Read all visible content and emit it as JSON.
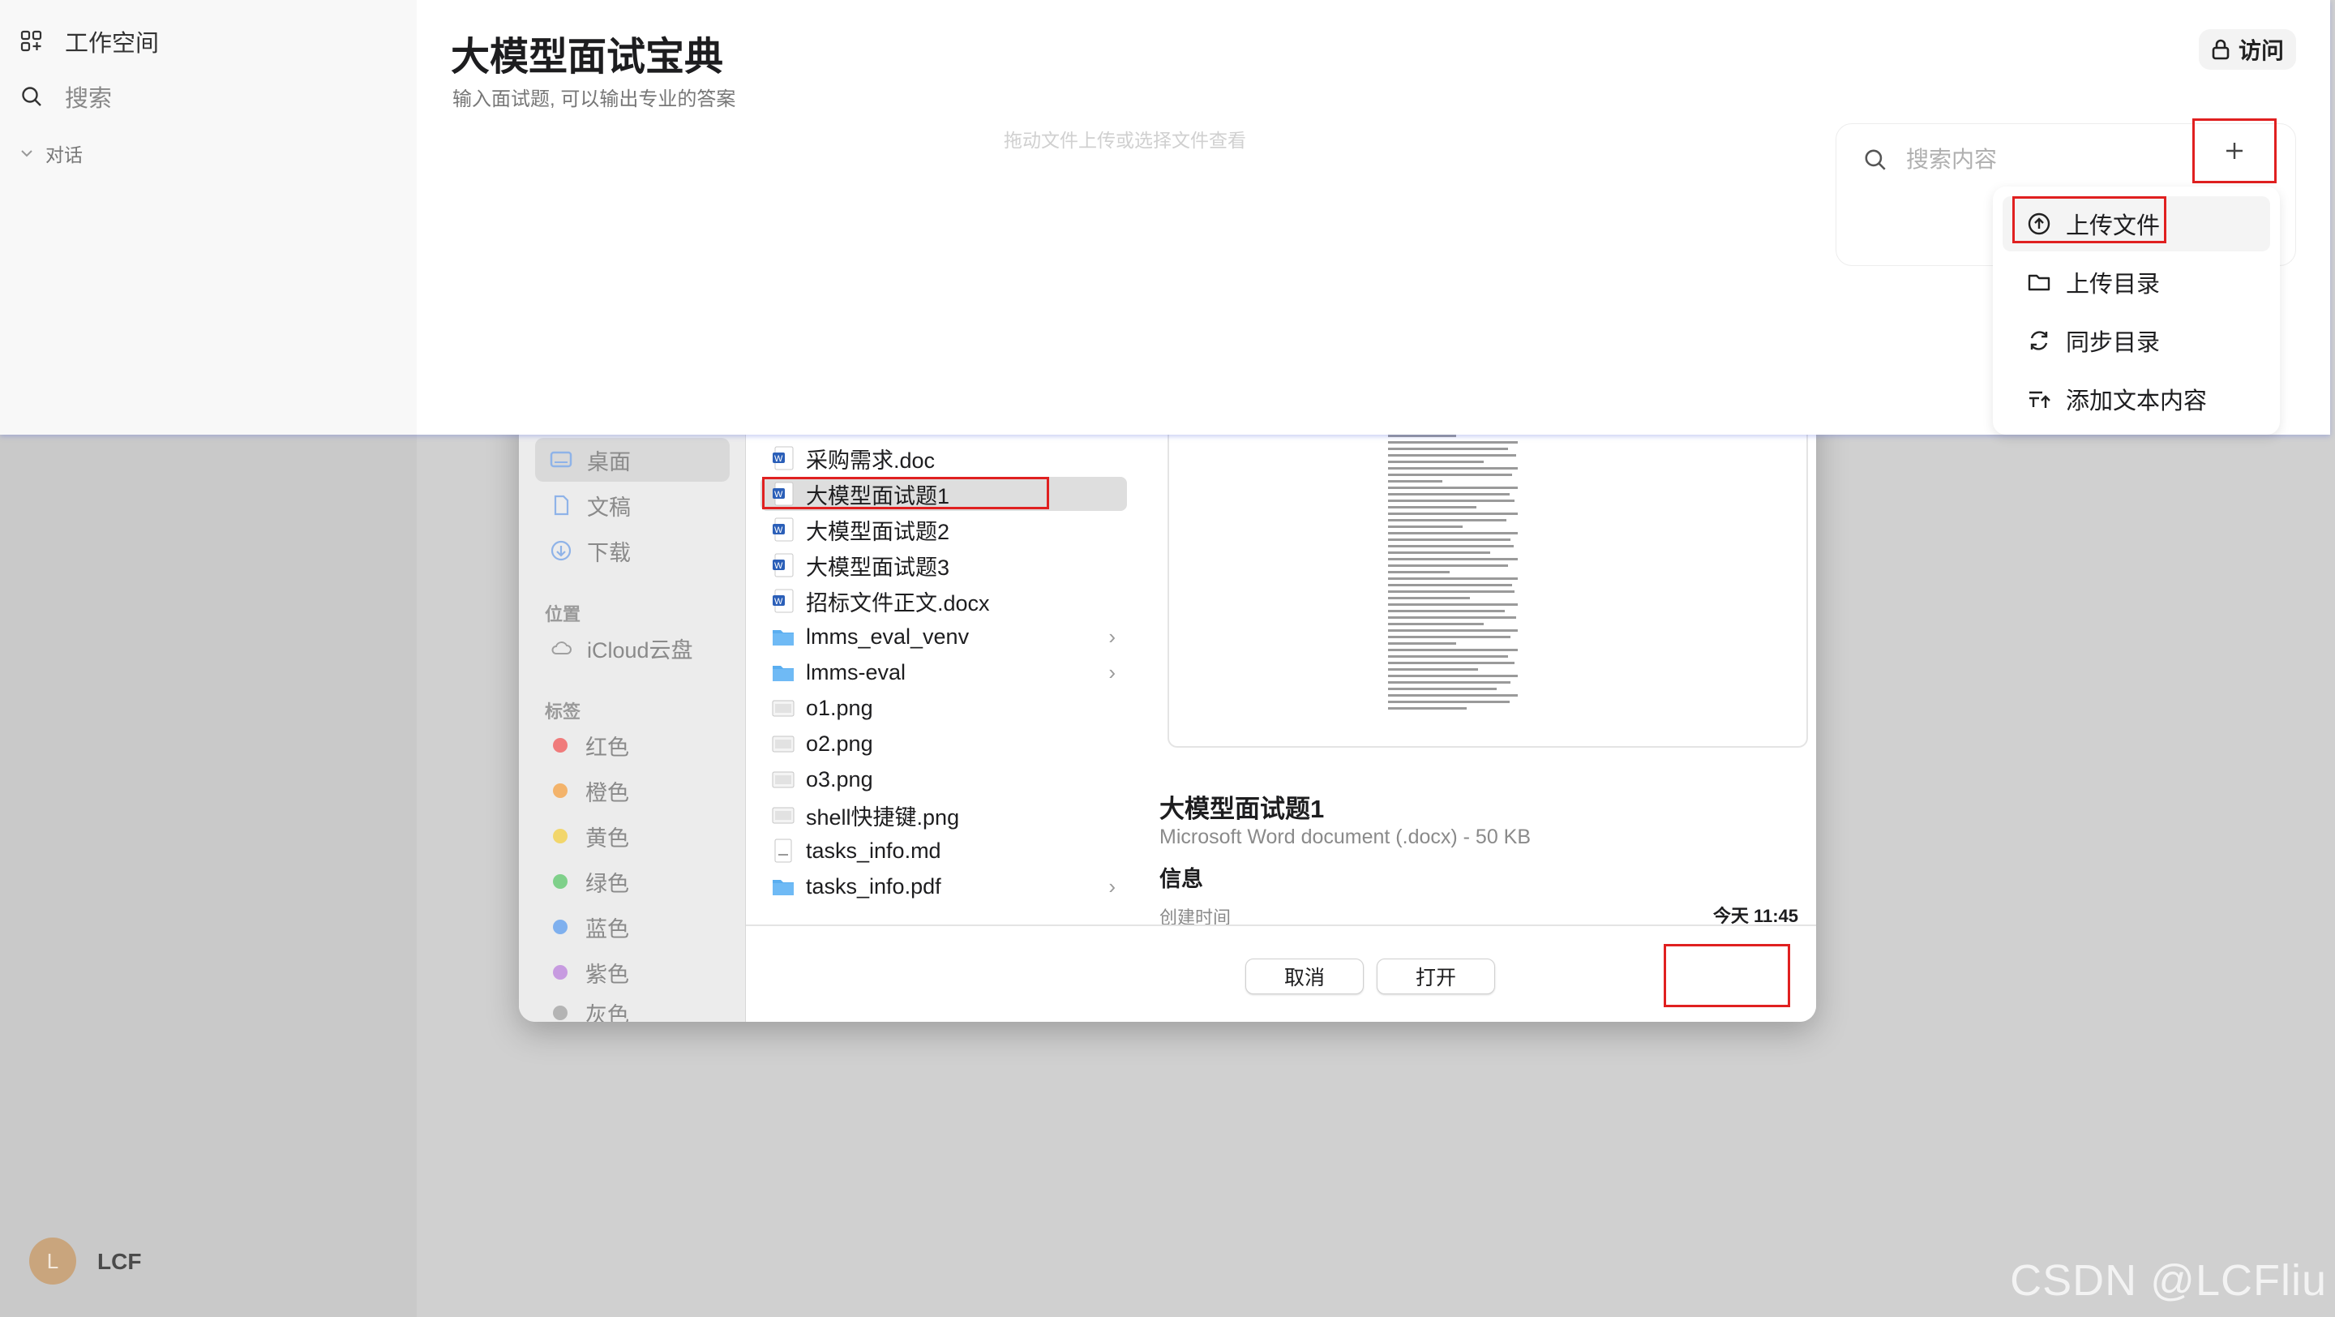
{
  "app": {
    "workspace_label": "工作空间",
    "search_label": "搜索",
    "conversations_label": "对话",
    "user_initial": "L",
    "user_name": "LCF"
  },
  "page": {
    "title": "大模型面试宝典",
    "subtitle": "输入面试题, 可以输出专业的答案",
    "drop_hint": "拖动文件上传或选择文件查看",
    "access_label": "访问",
    "search_placeholder": "搜索内容"
  },
  "upload_menu": {
    "items": [
      {
        "label": "上传文件",
        "icon": "upload-circle-icon"
      },
      {
        "label": "上传目录",
        "icon": "folder-icon"
      },
      {
        "label": "同步目录",
        "icon": "sync-icon"
      },
      {
        "label": "添加文本内容",
        "icon": "add-text-icon"
      }
    ]
  },
  "file_dialog": {
    "sidebar": {
      "favorites": [
        {
          "label": "桌面",
          "icon": "desktop-icon"
        },
        {
          "label": "文稿",
          "icon": "document-icon"
        },
        {
          "label": "下载",
          "icon": "download-icon"
        }
      ],
      "locations_header": "位置",
      "locations": [
        {
          "label": "iCloud云盘",
          "icon": "cloud-icon"
        }
      ],
      "tags_header": "标签",
      "tags": [
        {
          "label": "红色",
          "color": "#f07b7b"
        },
        {
          "label": "橙色",
          "color": "#f3b36b"
        },
        {
          "label": "黄色",
          "color": "#f2d66b"
        },
        {
          "label": "绿色",
          "color": "#7fd08a"
        },
        {
          "label": "蓝色",
          "color": "#7fb0ee"
        },
        {
          "label": "紫色",
          "color": "#c79be0"
        },
        {
          "label": "灰色",
          "color": "#b4b4b4"
        }
      ]
    },
    "files": [
      {
        "name": "采购需求.doc",
        "type": "word"
      },
      {
        "name": "大模型面试题1",
        "type": "word"
      },
      {
        "name": "大模型面试题2",
        "type": "word"
      },
      {
        "name": "大模型面试题3",
        "type": "word"
      },
      {
        "name": "招标文件正文.docx",
        "type": "word"
      },
      {
        "name": "lmms_eval_venv",
        "type": "folder"
      },
      {
        "name": "lmms-eval",
        "type": "folder"
      },
      {
        "name": "o1.png",
        "type": "image"
      },
      {
        "name": "o2.png",
        "type": "image"
      },
      {
        "name": "o3.png",
        "type": "image"
      },
      {
        "name": "shell快捷键.png",
        "type": "image"
      },
      {
        "name": "tasks_info.md",
        "type": "text"
      },
      {
        "name": "tasks_info.pdf",
        "type": "folder"
      }
    ],
    "preview": {
      "name": "大模型面试题1",
      "type_size": "Microsoft Word document (.docx) - 50 KB",
      "info_header": "信息",
      "created_label": "创建时间",
      "created_value": "今天 11:45"
    },
    "cancel_label": "取消",
    "open_label": "打开"
  },
  "watermark": "CSDN @LCFliu",
  "colors": {
    "annotation_red": "#e02020",
    "top_panel_shadow": "#5a6edc"
  }
}
